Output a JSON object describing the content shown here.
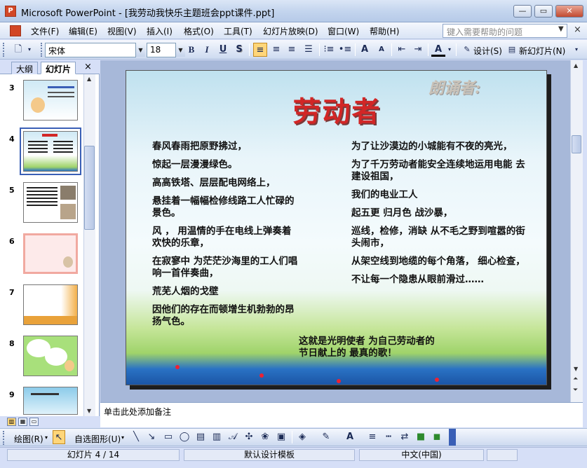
{
  "window": {
    "app_icon": "powerpoint-icon",
    "title": "Microsoft PowerPoint - [我劳动我快乐主题班会ppt课件.ppt]",
    "controls": [
      "minimize-icon",
      "maximize-icon",
      "close-icon"
    ]
  },
  "menu": {
    "items": [
      "文件(F)",
      "编辑(E)",
      "视图(V)",
      "插入(I)",
      "格式(O)",
      "工具(T)",
      "幻灯片放映(D)",
      "窗口(W)",
      "帮助(H)"
    ],
    "help_placeholder": "键入需要帮助的问题",
    "close_glyph": "×"
  },
  "toolbar": {
    "font_name": "宋体",
    "font_size": "18",
    "bold": "B",
    "italic": "I",
    "underline": "U",
    "shadow": "S",
    "font_color_glyph": "A",
    "grow_font": "A",
    "shrink_font": "A",
    "design_label": "设计(S)",
    "new_slide_label": "新幻灯片(N)"
  },
  "left_pane": {
    "tabs": [
      "大纲",
      "幻灯片"
    ],
    "active_tab": "幻灯片",
    "close_glyph": "×",
    "slides": [
      {
        "num": "3",
        "selected": false
      },
      {
        "num": "4",
        "selected": true
      },
      {
        "num": "5",
        "selected": false
      },
      {
        "num": "6",
        "selected": false
      },
      {
        "num": "7",
        "selected": false
      },
      {
        "num": "8",
        "selected": false
      },
      {
        "num": "9",
        "selected": false
      }
    ]
  },
  "slide": {
    "title": "劳动者",
    "corner_text": "朗诵者:",
    "left_column": [
      "春风春雨把原野拂过，",
      "惊起一层漫漫绿色。",
      "高高铁塔、层层配电网络上，",
      "悬挂着一幅幅检修线路工人忙碌的景色。",
      "风 ， 用温情的手在电线上弹奏着 欢快的乐章，",
      "在寂寥中 为茫茫沙海里的工人们唱响一首伴奏曲，",
      "荒芜人烟的戈壁",
      "因他们的存在而顿增生机勃勃的昂扬气色。"
    ],
    "right_column": [
      "为了让沙漠边的小城能有不夜的亮光，",
      "为了千万劳动者能安全连续地运用电能 去建设祖国，",
      "我们的电业工人",
      "起五更 归月色 战沙暴，",
      "巡线，检修，消缺 从不毛之野到喧嚣的街头闹市，",
      "从架空线到地缆的每个角落， 细心检查，",
      "不让每一个隐患从眼前滑过……"
    ],
    "closing": "这就是光明使者 为自己劳动者的节日献上的 最真的歌！"
  },
  "notes": {
    "placeholder": "单击此处添加备注"
  },
  "drawing_toolbar": {
    "draw_label": "绘图(R)",
    "autoshapes_label": "自选图形(U)"
  },
  "status": {
    "slide_info": "幻灯片 4 / 14",
    "template": "默认设计模板",
    "language": "中文(中国)"
  },
  "colors": {
    "accent": "#3a5fb6",
    "title_red": "#d22626",
    "chrome": "#d6dff7"
  }
}
